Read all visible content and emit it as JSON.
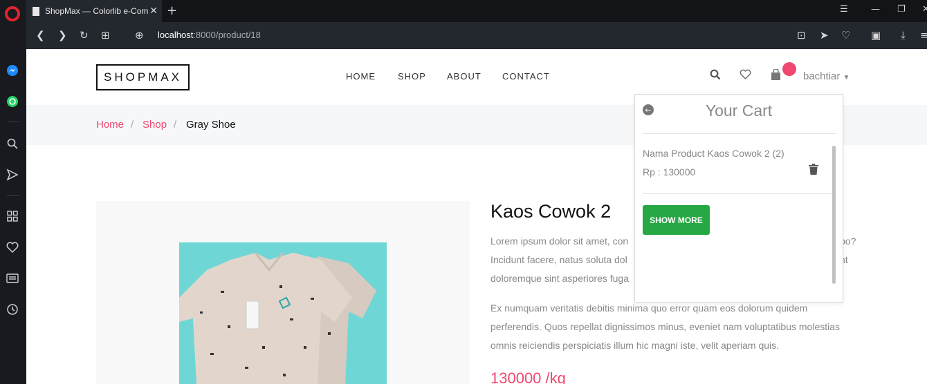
{
  "browser": {
    "tab_title": "ShopMax — Colorlib e-Commerce",
    "url_host": "localhost",
    "url_path": ":8000/product/18",
    "new_tab": "+",
    "close_tab": "✕"
  },
  "site": {
    "logo": "SHOPMAX",
    "nav": [
      "HOME",
      "SHOP",
      "ABOUT",
      "CONTACT"
    ],
    "user": "bachtiar"
  },
  "breadcrumb": {
    "home": "Home",
    "shop": "Shop",
    "current": "Gray Shoe",
    "separator": "/"
  },
  "product": {
    "title": "Kaos Cowok 2",
    "desc1_lines": [
      "Lorem ipsum dolor sit amet, con",
      "Incidunt facere, natus soluta dol",
      "doloremque sint asperiores fuga"
    ],
    "desc1_right": [
      "bo?",
      "nt"
    ],
    "desc2_lines": [
      "Ex numquam veritatis debitis minima quo error quam eos dolorum quidem",
      "perferendis. Quos repellat dignissimos minus, eveniet nam voluptatibus molestias",
      "omnis reiciendis perspiciatis illum hic magni iste, velit aperiam quis."
    ],
    "price": "130000 /kg"
  },
  "cart": {
    "title": "Your Cart",
    "item_name": "Nama Product Kaos Cowok 2 (2)",
    "item_price": "Rp : 130000",
    "show_more": "SHOW MORE"
  },
  "colors": {
    "accent": "#ef476f",
    "button_green": "#28a745",
    "browser_dark": "#23272e"
  }
}
